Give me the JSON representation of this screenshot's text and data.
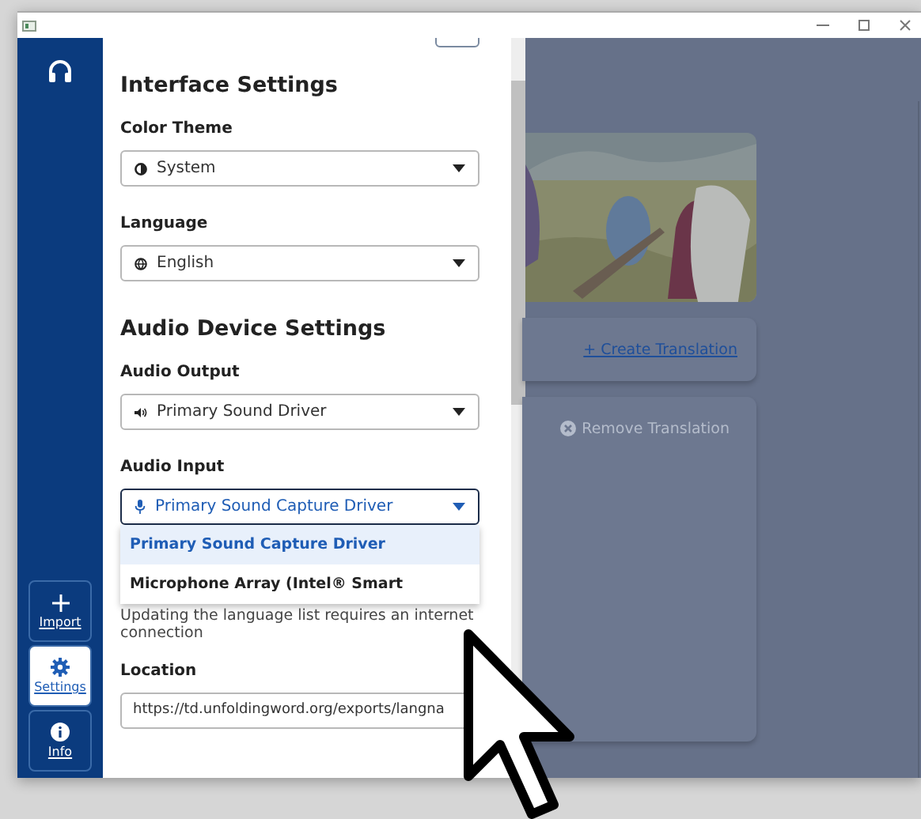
{
  "sidebar": {
    "items": [
      {
        "kind": "import",
        "label": "Import",
        "selected": false
      },
      {
        "kind": "settings",
        "label": "Settings",
        "selected": true
      },
      {
        "kind": "info",
        "label": "Info",
        "selected": false
      }
    ]
  },
  "settings": {
    "sections": [
      {
        "title": "Interface Settings",
        "fields": [
          {
            "label": "Color Theme",
            "kind": "theme",
            "value": "System",
            "focused": false
          },
          {
            "label": "Language",
            "kind": "globe",
            "value": "English",
            "focused": false
          }
        ]
      },
      {
        "title": "Audio Device Settings",
        "fields": [
          {
            "label": "Audio Output",
            "kind": "speaker",
            "value": "Primary Sound Driver",
            "focused": false
          },
          {
            "label": "Audio Input",
            "kind": "mic",
            "value": "Primary Sound Capture Driver",
            "focused": true,
            "options": [
              {
                "label": "Primary Sound Capture Driver",
                "selected": true
              },
              {
                "label": "Microphone Array (Intel® Smart",
                "selected": false
              }
            ]
          }
        ]
      }
    ],
    "help_text": "Updating the language list requires an internet connection",
    "location": {
      "label": "Location",
      "value": "https://td.unfoldingword.org/exports/langna"
    }
  },
  "background": {
    "create_button": "+ Create Translation",
    "remove_button": {
      "label": "Remove Translation",
      "disabled": true
    }
  }
}
